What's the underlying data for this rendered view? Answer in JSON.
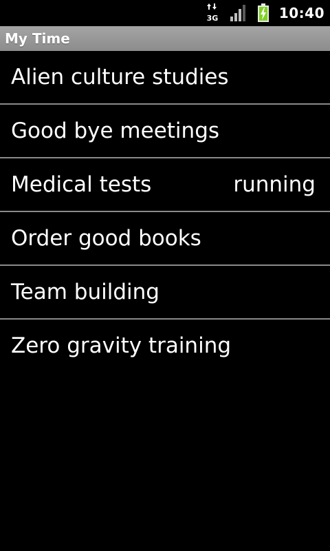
{
  "status_bar": {
    "network_type": "3G",
    "clock": "10:40",
    "icons": [
      "data-arrows-icon",
      "signal-strength-icon",
      "battery-charging-icon"
    ]
  },
  "app": {
    "title": "My Time"
  },
  "tasks": [
    {
      "label": "Alien culture studies",
      "status": ""
    },
    {
      "label": "Good bye meetings",
      "status": ""
    },
    {
      "label": "Medical tests",
      "status": "running"
    },
    {
      "label": "Order good books",
      "status": ""
    },
    {
      "label": "Team building",
      "status": ""
    },
    {
      "label": "Zero gravity training",
      "status": ""
    }
  ],
  "colors": {
    "background": "#000000",
    "title_bar": "#9a9a9a",
    "divider": "#8a8a8a",
    "battery_green": "#7fd321"
  }
}
